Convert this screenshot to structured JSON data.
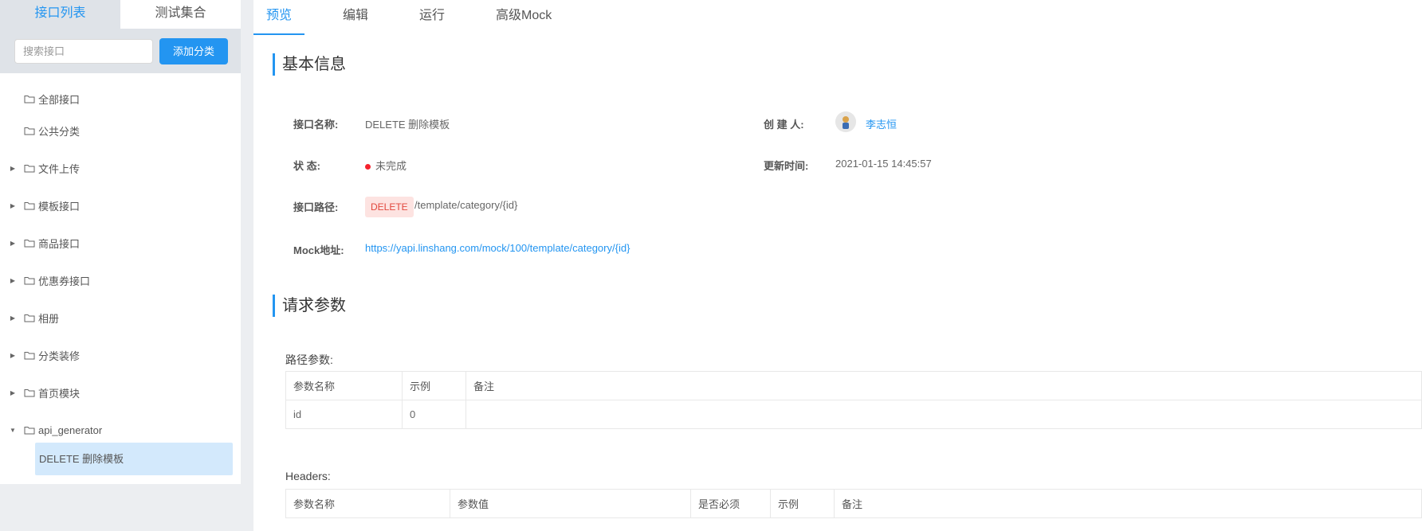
{
  "sidebar": {
    "tabs": [
      "接口列表",
      "测试集合"
    ],
    "search_placeholder": "搜索接口",
    "add_button": "添加分类",
    "categories": [
      {
        "label": "全部接口",
        "caret": ""
      },
      {
        "label": "公共分类",
        "caret": ""
      },
      {
        "label": "文件上传",
        "caret": "▶"
      },
      {
        "label": "模板接口",
        "caret": "▶"
      },
      {
        "label": "商品接口",
        "caret": "▶"
      },
      {
        "label": "优惠券接口",
        "caret": "▶"
      },
      {
        "label": "相册",
        "caret": "▶"
      },
      {
        "label": "分类装修",
        "caret": "▶"
      },
      {
        "label": "首页模块",
        "caret": "▶"
      },
      {
        "label": "api_generator",
        "caret": "▼"
      }
    ],
    "selected_leaf": "DELETE 删除模板"
  },
  "tabs": [
    "预览",
    "编辑",
    "运行",
    "高级Mock"
  ],
  "basic": {
    "title": "基本信息",
    "name_label": "接口名称:",
    "name_value": "DELETE 删除模板",
    "creator_label": "创 建 人:",
    "creator_value": "李志恒",
    "status_label": "状 态:",
    "status_value": "未完成",
    "updated_label": "更新时间:",
    "updated_value": "2021-01-15 14:45:57",
    "path_label": "接口路径:",
    "path_method": "DELETE",
    "path_value": "/template/category/{id}",
    "mock_label": "Mock地址:",
    "mock_value": "https://yapi.linshang.com/mock/100/template/category/{id}"
  },
  "request": {
    "title": "请求参数",
    "path_params_label": "路径参数:",
    "path_params_headers": [
      "参数名称",
      "示例",
      "备注"
    ],
    "path_params_rows": [
      [
        "id",
        "0",
        ""
      ]
    ],
    "headers_label": "Headers:",
    "headers_headers": [
      "参数名称",
      "参数值",
      "是否必须",
      "示例",
      "备注"
    ]
  },
  "colors": {
    "accent": "#2395f1",
    "delete_tag_bg": "#fde3e1",
    "delete_tag_text": "#e2483d",
    "status_dot": "#f5222d"
  }
}
